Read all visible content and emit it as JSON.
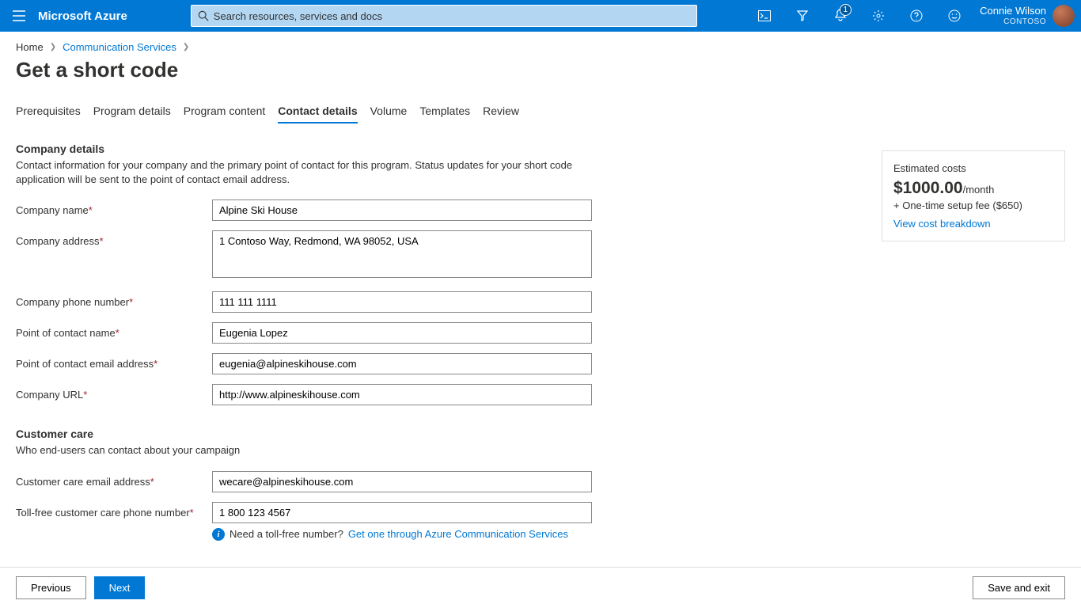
{
  "header": {
    "product": "Microsoft Azure",
    "search_placeholder": "Search resources, services and docs",
    "notification_count": "1",
    "account_name": "Connie Wilson",
    "account_directory": "CONTOSO"
  },
  "breadcrumb": {
    "home": "Home",
    "service": "Communication Services"
  },
  "page": {
    "title": "Get a short code"
  },
  "tabs": [
    {
      "label": "Prerequisites"
    },
    {
      "label": "Program details"
    },
    {
      "label": "Program content"
    },
    {
      "label": "Contact details"
    },
    {
      "label": "Volume"
    },
    {
      "label": "Templates"
    },
    {
      "label": "Review"
    }
  ],
  "sections": {
    "company": {
      "title": "Company details",
      "desc": "Contact information for your company and the primary point of contact for this program. Status updates for your short code application will be sent to the point of contact email address.",
      "fields": {
        "company_name": {
          "label": "Company name",
          "value": "Alpine Ski House"
        },
        "company_address": {
          "label": "Company address",
          "value": "1 Contoso Way, Redmond, WA 98052, USA"
        },
        "company_phone": {
          "label": "Company phone number",
          "value": "111 111 1111"
        },
        "poc_name": {
          "label": "Point of contact name",
          "value": "Eugenia Lopez"
        },
        "poc_email": {
          "label": "Point of contact email address",
          "value": "eugenia@alpineskihouse.com"
        },
        "company_url": {
          "label": "Company URL",
          "value": "http://www.alpineskihouse.com"
        }
      }
    },
    "customer_care": {
      "title": "Customer care",
      "desc": "Who end-users can contact about your campaign",
      "fields": {
        "cc_email": {
          "label": "Customer care email address",
          "value": "wecare@alpineskihouse.com"
        },
        "cc_phone": {
          "label": "Toll-free customer care phone number",
          "value": "1 800 123 4567"
        }
      },
      "info_text": "Need a toll-free number?",
      "info_link": "Get one through Azure Communication Services"
    }
  },
  "cost_card": {
    "title": "Estimated costs",
    "amount": "$1000.00",
    "period": "/month",
    "setup": "+ One-time setup fee ($650)",
    "link": "View cost breakdown"
  },
  "footer": {
    "previous": "Previous",
    "next": "Next",
    "save_exit": "Save and exit"
  }
}
